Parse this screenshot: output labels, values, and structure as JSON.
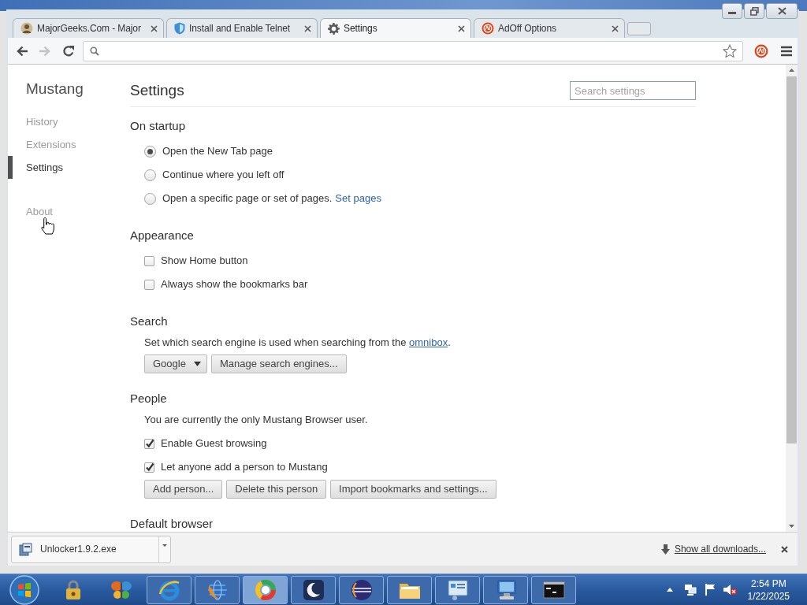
{
  "tabs": [
    {
      "title": "MajorGeeks.Com - Major",
      "selected": false
    },
    {
      "title": "Install and Enable Telnet",
      "selected": false
    },
    {
      "title": "Settings",
      "selected": true
    },
    {
      "title": "AdOff Options",
      "selected": false
    }
  ],
  "sidebar": {
    "title": "Mustang",
    "groups": [
      {
        "items": [
          {
            "label": "History",
            "selected": false
          },
          {
            "label": "Extensions",
            "selected": false
          },
          {
            "label": "Settings",
            "selected": true
          }
        ]
      },
      {
        "items": [
          {
            "label": "About",
            "selected": false
          }
        ]
      }
    ]
  },
  "page": {
    "title": "Settings",
    "search": {
      "placeholder": "Search settings"
    }
  },
  "sections": [
    {
      "title": "On startup",
      "rows": [
        {
          "kind": "radio",
          "label": "Open the New Tab page",
          "selected": true
        },
        {
          "kind": "radio",
          "label": "Continue where you left off",
          "selected": false
        },
        {
          "kind": "radio",
          "label": "Open a specific page or set of pages.",
          "link": "Set pages",
          "selected": false
        }
      ]
    },
    {
      "title": "Appearance",
      "rows": [
        {
          "kind": "checkbox",
          "label": "Show Home button",
          "checked": false
        },
        {
          "kind": "checkbox",
          "label": "Always show the bookmarks bar",
          "checked": false
        }
      ]
    },
    {
      "title": "Search",
      "rows": [
        {
          "kind": "text",
          "text": "Set which search engine is used when searching from the",
          "link": "omnibox",
          "after": "."
        },
        {
          "kind": "buttons",
          "buttons": [
            {
              "kind": "dropdown",
              "label": "Google"
            },
            {
              "kind": "button",
              "label": "Manage search engines..."
            }
          ]
        }
      ]
    },
    {
      "title": "People",
      "rows": [
        {
          "kind": "text",
          "text": "You are currently the only Mustang Browser user."
        },
        {
          "kind": "checkbox",
          "label": "Enable Guest browsing",
          "checked": true
        },
        {
          "kind": "checkbox",
          "label": "Let anyone add a person to Mustang",
          "checked": true
        },
        {
          "kind": "buttons",
          "buttons": [
            {
              "kind": "button",
              "label": "Add person..."
            },
            {
              "kind": "button",
              "label": "Delete this person"
            },
            {
              "kind": "button",
              "label": "Import bookmarks and settings..."
            }
          ]
        }
      ]
    },
    {
      "title": "Default browser"
    }
  ],
  "downloads": {
    "items": [
      {
        "name": "Unlocker1.9.2.exe"
      }
    ],
    "show_all": "Show all downloads..."
  },
  "taskbar": {
    "apps": [
      {
        "running": false,
        "selected": false
      },
      {
        "running": false,
        "selected": false
      },
      {
        "running": true,
        "selected": false
      },
      {
        "running": true,
        "selected": false
      },
      {
        "running": true,
        "selected": true
      },
      {
        "running": true,
        "selected": false
      },
      {
        "running": true,
        "selected": false
      },
      {
        "running": true,
        "selected": false
      },
      {
        "running": true,
        "selected": false
      },
      {
        "running": true,
        "selected": false
      },
      {
        "running": true,
        "selected": false
      }
    ],
    "clock": {
      "time": "2:54 PM",
      "date": "1/22/2025"
    }
  }
}
